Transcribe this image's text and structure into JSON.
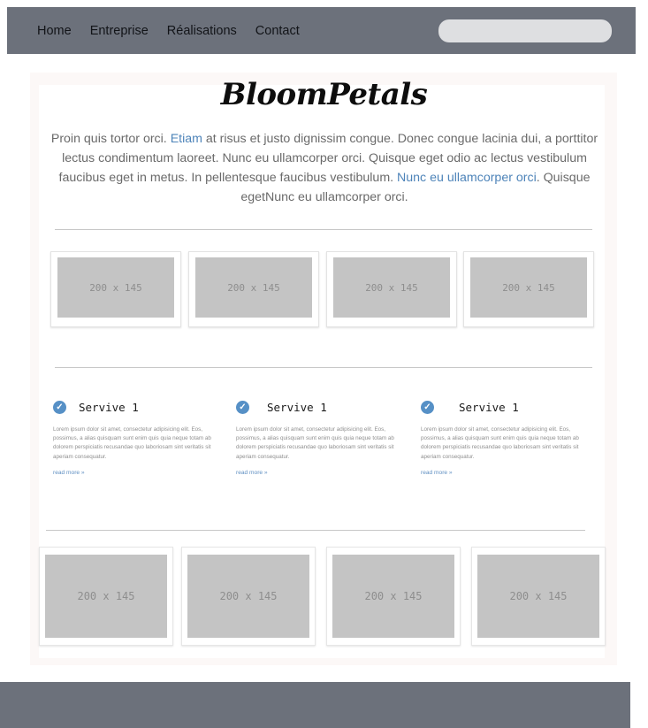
{
  "nav": {
    "items": [
      "Home",
      "Entreprise",
      "Réalisations",
      "Contact"
    ],
    "search_placeholder": ""
  },
  "brand": {
    "logo": "BloomPetals"
  },
  "intro": {
    "p1": "Proin quis tortor orci. ",
    "l1": "Etiam",
    "p2": " at risus et justo dignissim congue. Donec congue lacinia dui, a porttitor lectus condimentum laoreet. Nunc eu ullamcorper orci. Quisque eget odio ac lectus vestibulum faucibus eget in metus. In pellentesque faucibus vestibulum. ",
    "l2": "Nunc eu ullamcorper orci",
    "p3": ". Quisque egetNunc eu ullamcorper orci."
  },
  "gallery_top": [
    "200 x 145",
    "200 x 145",
    "200 x 145",
    "200 x 145"
  ],
  "services": [
    {
      "title": "Servive 1",
      "body": "Lorem ipsum dolor sit amet, consectetur adipisicing elit. Eos, possimus, a alias quisquam sunt enim quis quia neque totam ab dolorem perspiciatis recusandae quo laboriosam sint veritatis sit aperiam consequatur.",
      "more": "read more »"
    },
    {
      "title": "Servive 1",
      "body": "Lorem ipsum dolor sit amet, consectetur adipisicing elit. Eos, possimus, a alias quisquam sunt enim quis quia neque totam ab dolorem perspiciatis recusandae quo laboriosam sint veritatis sit aperiam consequatur.",
      "more": "read more »"
    },
    {
      "title": "Servive 1",
      "body": "Lorem ipsum dolor sit amet, consectetur adipisicing elit. Eos, possimus, a alias quisquam sunt enim quis quia neque totam ab dolorem perspiciatis recusandae quo laboriosam sint veritatis sit aperiam consequatur.",
      "more": "read more »"
    }
  ],
  "gallery_bottom": [
    "200 x 145",
    "200 x 145",
    "200 x 145",
    "200 x 145"
  ],
  "colors": {
    "bar": "#6c717b",
    "link": "#4e84b9",
    "check": "#5690c6",
    "placeholder": "#c4c4c4"
  }
}
